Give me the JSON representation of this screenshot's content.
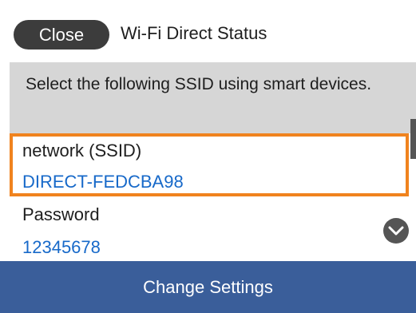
{
  "header": {
    "close_label": "Close",
    "title": "Wi-Fi Direct Status"
  },
  "info": {
    "message": "Select the following SSID using smart devices."
  },
  "fields": {
    "ssid_label": "network (SSID)",
    "ssid_value": "DIRECT-FEDCBA98",
    "password_label": "Password",
    "password_value": "12345678"
  },
  "footer": {
    "change_settings_label": "Change Settings"
  },
  "icons": {
    "scroll_down": "chevron-down-icon"
  },
  "colors": {
    "highlight_border": "#f0831e",
    "value_text": "#1769c9",
    "footer_bg": "#3a5e9a",
    "close_bg": "#3c3c3c",
    "panel_bg": "#d6d6d6"
  }
}
